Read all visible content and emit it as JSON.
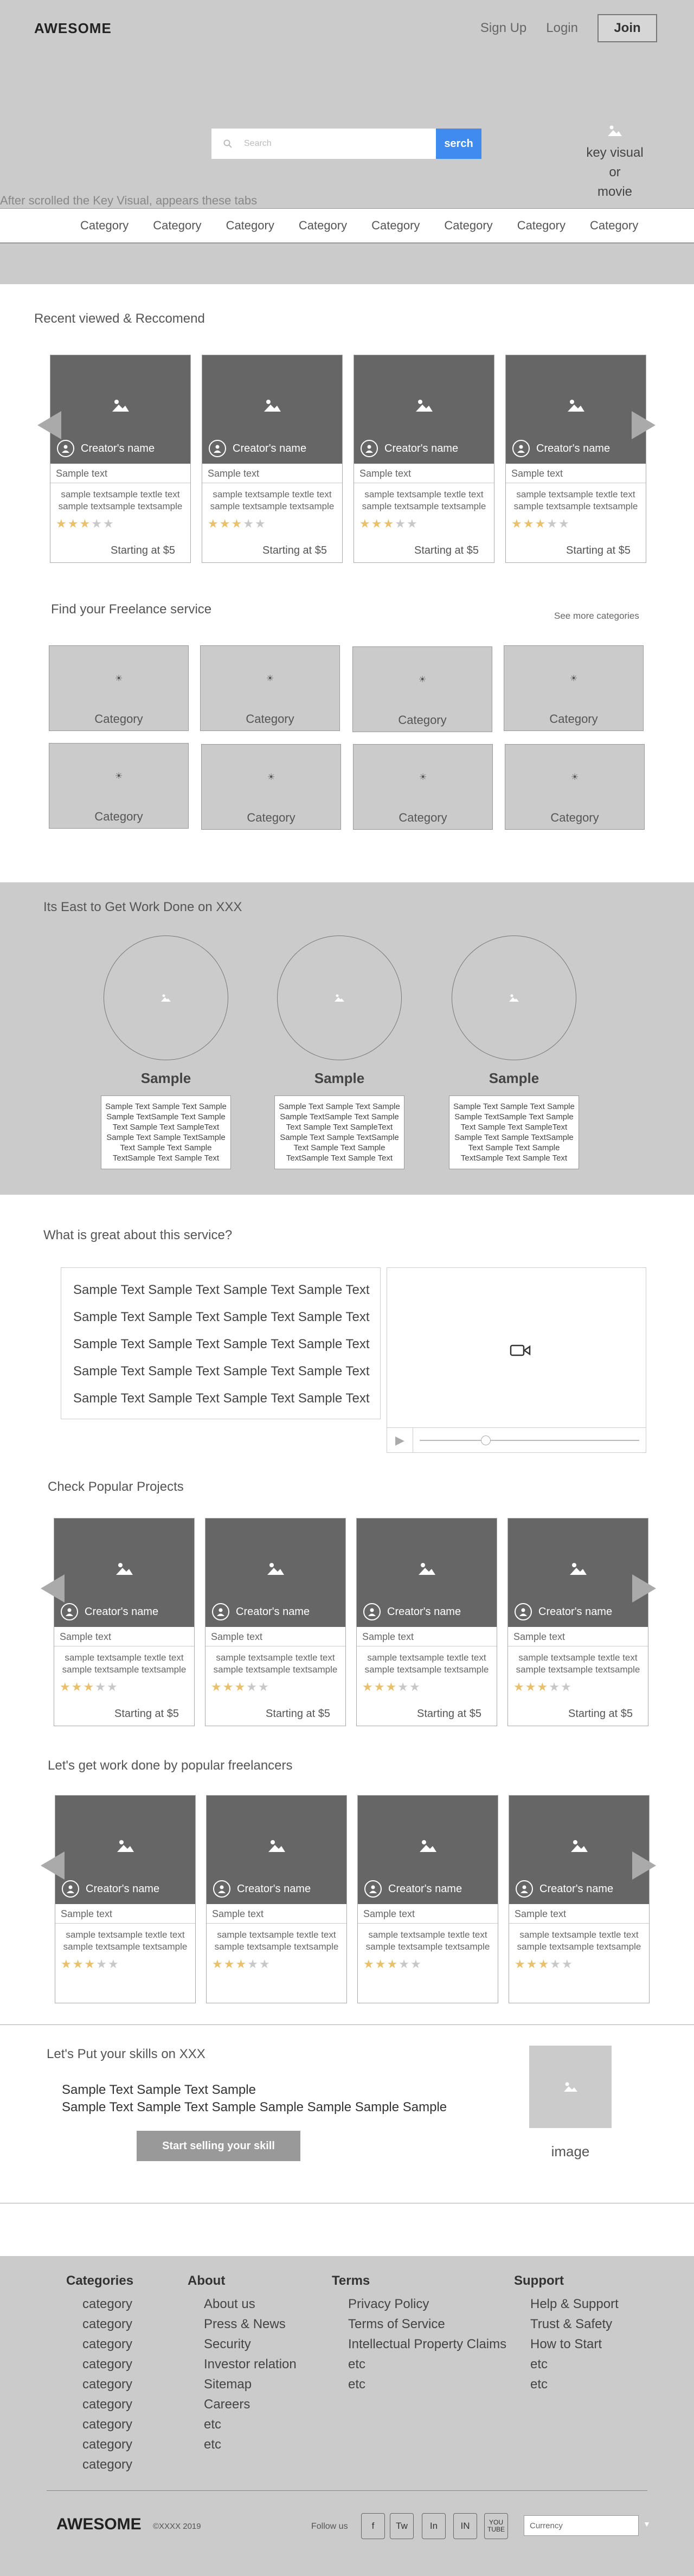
{
  "header": {
    "logo": "AWESOME",
    "nav": [
      "Sign Up",
      "Login"
    ],
    "join_label": "Join",
    "search_placeholder": "Search",
    "search_button": "serch",
    "key_visual": [
      "key visual",
      "or",
      "movie"
    ],
    "scroll_note": "After scrolled the Key Visual, appears these tabs",
    "categories": [
      "Category",
      "Category",
      "Category",
      "Category",
      "Category",
      "Category",
      "Category",
      "Category"
    ]
  },
  "recent": {
    "title": "Recent viewed & Reccomend",
    "cards": [
      {
        "creator": "Creator's name",
        "sample": "Sample text",
        "desc1": "sample textsample textle text",
        "desc2": "sample textsample textsample",
        "rating": 3,
        "price": "Starting at $5"
      },
      {
        "creator": "Creator's name",
        "sample": "Sample text",
        "desc1": "sample textsample textle text",
        "desc2": "sample textsample textsample",
        "rating": 3,
        "price": "Starting at $5"
      },
      {
        "creator": "Creator's name",
        "sample": "Sample text",
        "desc1": "sample textsample textle text",
        "desc2": "sample textsample textsample",
        "rating": 3,
        "price": "Starting at $5"
      },
      {
        "creator": "Creator's name",
        "sample": "Sample text",
        "desc1": "sample textsample textle text",
        "desc2": "sample textsample textsample",
        "rating": 3,
        "price": "Starting at $5"
      }
    ]
  },
  "freelance": {
    "title": "Find your Freelance service",
    "see_more": "See more categories",
    "tiles": [
      "Category",
      "Category",
      "Category",
      "Category",
      "Category",
      "Category",
      "Category",
      "Category"
    ]
  },
  "easy": {
    "title": "Its East to Get Work Done on XXX",
    "steps": [
      {
        "name": "Sample",
        "text": "Sample Text Sample Text Sample Sample TextSample Text Sample Text Sample Text SampleText Sample Text Sample TextSample Text Sample Text Sample TextSample Text Sample Text"
      },
      {
        "name": "Sample",
        "text": "Sample Text Sample Text Sample Sample TextSample Text Sample Text Sample Text SampleText Sample Text Sample TextSample Text Sample Text Sample TextSample Text Sample Text"
      },
      {
        "name": "Sample",
        "text": "Sample Text Sample Text Sample Sample TextSample Text Sample Text Sample Text SampleText Sample Text Sample TextSample Text Sample Text Sample TextSample Text Sample Text"
      }
    ]
  },
  "great": {
    "title": "What is great about this service?",
    "lines": [
      "Sample Text Sample Text Sample Text Sample Text",
      "Sample Text Sample Text Sample Text Sample Text",
      "Sample Text Sample Text Sample Text Sample Text",
      "Sample Text Sample Text Sample Text Sample Text",
      "Sample Text Sample Text Sample Text Sample Text"
    ],
    "video_progress": 0.28
  },
  "popular": {
    "title": "Check Popular Projects",
    "cards": [
      {
        "creator": "Creator's name",
        "sample": "Sample text",
        "desc1": "sample textsample textle text",
        "desc2": "sample textsample textsample",
        "rating": 3,
        "price": "Starting at $5"
      },
      {
        "creator": "Creator's name",
        "sample": "Sample text",
        "desc1": "sample textsample textle text",
        "desc2": "sample textsample textsample",
        "rating": 3,
        "price": "Starting at $5"
      },
      {
        "creator": "Creator's name",
        "sample": "Sample text",
        "desc1": "sample textsample textle text",
        "desc2": "sample textsample textsample",
        "rating": 3,
        "price": "Starting at $5"
      },
      {
        "creator": "Creator's name",
        "sample": "Sample text",
        "desc1": "sample textsample textle text",
        "desc2": "sample textsample textsample",
        "rating": 3,
        "price": "Starting at $5"
      }
    ]
  },
  "freelancers": {
    "title": "Let's get work done by popular freelancers",
    "cards": [
      {
        "creator": "Creator's name",
        "sample": "Sample text",
        "desc1": "sample textsample textle text",
        "desc2": "sample textsample textsample",
        "rating": 3,
        "price": ""
      },
      {
        "creator": "Creator's name",
        "sample": "Sample text",
        "desc1": "sample textsample textle text",
        "desc2": "sample textsample textsample",
        "rating": 3,
        "price": ""
      },
      {
        "creator": "Creator's name",
        "sample": "Sample text",
        "desc1": "sample textsample textle text",
        "desc2": "sample textsample textsample",
        "rating": 3,
        "price": ""
      },
      {
        "creator": "Creator's name",
        "sample": "Sample text",
        "desc1": "sample textsample textle text",
        "desc2": "sample textsample textsample",
        "rating": 3,
        "price": ""
      }
    ]
  },
  "skills": {
    "title": "Let's Put your skills on XXX",
    "line1": "Sample Text Sample Text Sample",
    "line2": "Sample Text Sample Text Sample Sample Sample Sample Sample",
    "button": "Start selling your skill",
    "image_label": "image"
  },
  "footer": {
    "categories": {
      "title": "Categories",
      "items": [
        "category",
        "category",
        "category",
        "category",
        "category",
        "category",
        "category",
        "category",
        "category"
      ]
    },
    "about": {
      "title": "About",
      "items": [
        "About us",
        "Press & News",
        "Security",
        "Investor relation",
        "Sitemap",
        "Careers",
        "etc",
        "etc"
      ]
    },
    "terms": {
      "title": "Terms",
      "items": [
        "Privacy Policy",
        "Terms of Service",
        "Intellectual Property Claims",
        "etc",
        "etc"
      ]
    },
    "support": {
      "title": "Support",
      "items": [
        "Help & Support",
        "Trust & Safety",
        "How to Start",
        "etc",
        "etc"
      ]
    },
    "logo": "AWESOME",
    "copyright": "©XXXX 2019",
    "follow": "Follow us",
    "social": [
      "f",
      "Tw",
      "In",
      "IN",
      "YOU TUBE"
    ],
    "currency": "Currency"
  }
}
